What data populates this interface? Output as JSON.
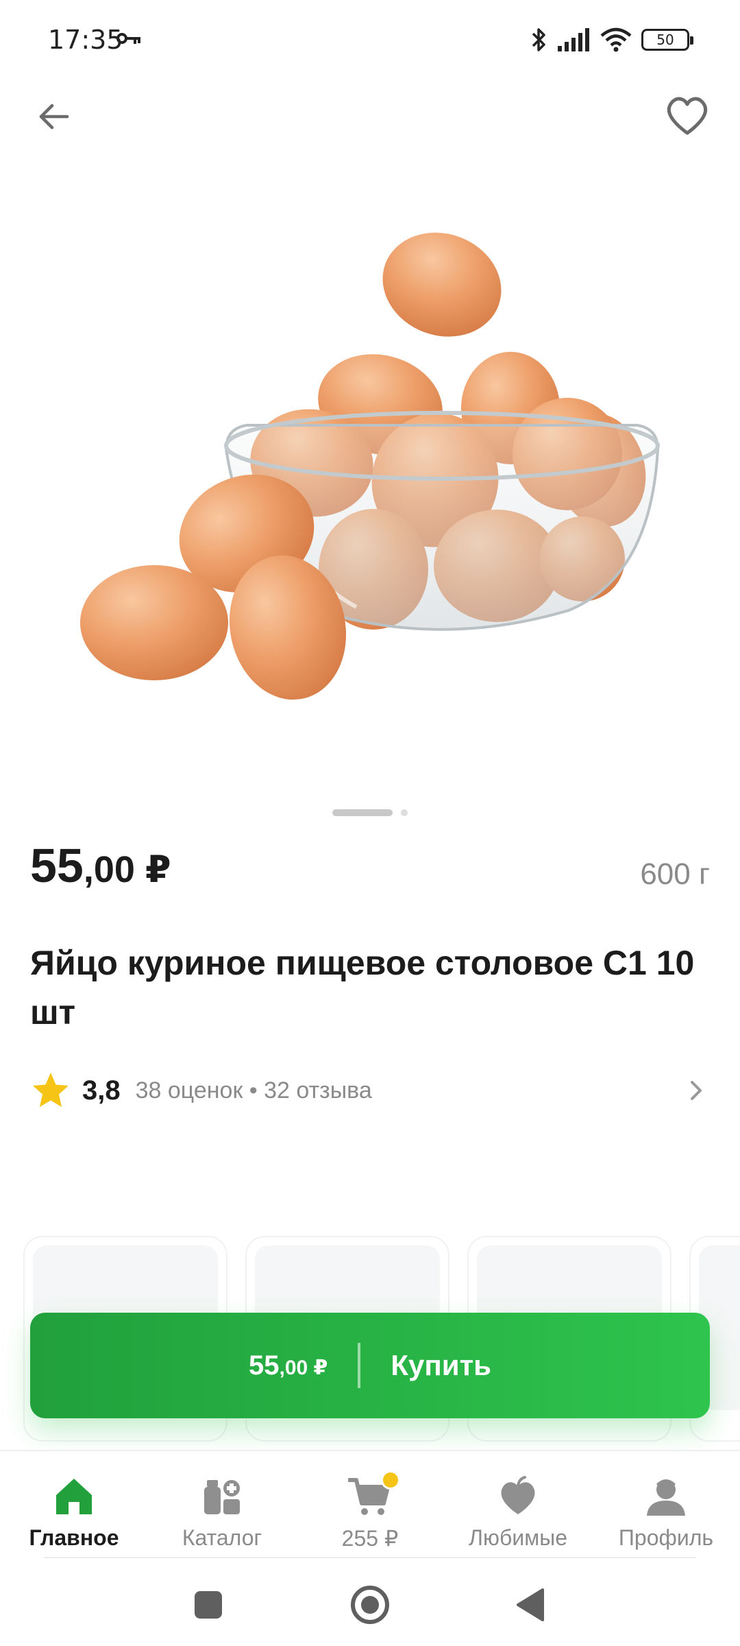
{
  "status_bar": {
    "time": "17:35",
    "battery": "50",
    "icons": [
      "key-icon",
      "bluetooth-icon",
      "signal-icon",
      "wifi-icon",
      "battery-icon"
    ]
  },
  "top_bar": {
    "back_icon": "arrow-left-icon",
    "favorite_icon": "heart-outline-icon"
  },
  "product": {
    "image_icon": "eggs-in-glass-bowl",
    "pager": {
      "count": 2,
      "active": 0
    },
    "price_main": "55",
    "price_cents": ",00 ₽",
    "weight": "600 г",
    "title": "Яйцо куриное пищевое столовое С1 10 шт",
    "rating": {
      "value": "3,8",
      "meta": "38 оценок • 32 отзыва"
    }
  },
  "buy_button": {
    "price_main": "55",
    "price_cents": ",00 ₽",
    "label": "Купить"
  },
  "bottom_nav": {
    "items": [
      {
        "label": "Главное",
        "icon": "home-icon",
        "active": true
      },
      {
        "label": "Каталог",
        "icon": "catalog-icon",
        "active": false
      },
      {
        "label": "255 ₽",
        "icon": "cart-icon",
        "active": false
      },
      {
        "label": "Любимые",
        "icon": "heart-apple-icon",
        "active": false
      },
      {
        "label": "Профиль",
        "icon": "profile-icon",
        "active": false
      }
    ]
  },
  "colors": {
    "accent_green": "#2ec44d",
    "active_icon_green": "#21a03c",
    "star_yellow": "#f6c415",
    "muted_text": "#8a8a8a"
  }
}
